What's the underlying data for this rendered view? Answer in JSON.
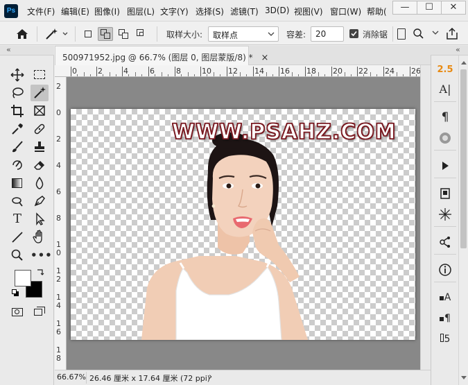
{
  "app": {
    "logo_text": "Ps",
    "accent": "#31a8ff",
    "logo_bg": "#001e36"
  },
  "menu": {
    "items": [
      "文件(F)",
      "编辑(E)",
      "图像(I)",
      "图层(L)",
      "文字(Y)",
      "选择(S)",
      "滤镜(T)",
      "3D(D)",
      "视图(V)",
      "窗口(W)",
      "帮助("
    ]
  },
  "window_controls": {
    "minimize": "—",
    "maximize": "☐",
    "close": "✕"
  },
  "options": {
    "home_icon": "home-icon",
    "tool_icon": "magic-wand-icon",
    "sample_size_label": "取样大小:",
    "sample_size_value": "取样点",
    "tolerance_label": "容差:",
    "tolerance_value": "20",
    "anti_alias_label": "消除锯",
    "anti_alias_checked": true
  },
  "document": {
    "tab_title": "500971952.jpg @ 66.7% (图层 0, 图层蒙版/8) *",
    "close": "×",
    "watermark": "WWW.PSAHZ.COM",
    "watermark_color": "#ffffff",
    "watermark_outline": "#7a1b22"
  },
  "ruler": {
    "h_labels": [
      "0",
      "2",
      "4",
      "6",
      "8",
      "10",
      "12",
      "14",
      "16",
      "18",
      "20",
      "22",
      "24",
      "26"
    ],
    "v_labels": [
      "2",
      "0",
      "2",
      "4",
      "6",
      "8",
      "1\n0",
      "1\n2",
      "1\n4",
      "1\n6",
      "1\n8"
    ]
  },
  "status": {
    "zoom": "66.67%",
    "doc_size": "26.46 厘米 x 17.64 厘米 (72 ppi)",
    "arrow": "›"
  },
  "right_panel": {
    "version_label": "2.5",
    "collapse": "«"
  },
  "tools": {
    "collapse": "«",
    "foreground_color": "#ffffff",
    "background_color": "#000000"
  }
}
